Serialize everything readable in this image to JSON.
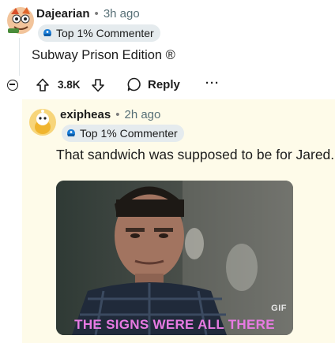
{
  "top_comment": {
    "username": "Dajearian",
    "time": "3h ago",
    "flair": "Top 1% Commenter",
    "body": "Subway Prison Edition ®"
  },
  "actions": {
    "score": "3.8K",
    "reply_label": "Reply",
    "more_label": "···"
  },
  "reply_comment": {
    "username": "exipheas",
    "time": "2h ago",
    "flair": "Top 1% Commenter",
    "body": "That sandwich was supposed to be for Jared.",
    "gif": {
      "label": "GIF",
      "caption": "THE SIGNS WERE ALL THERE"
    }
  },
  "separator": "•",
  "colors": {
    "reply_background": "#fefbe9",
    "flair_background": "#e5ebee",
    "caption": "#e77ae2"
  }
}
